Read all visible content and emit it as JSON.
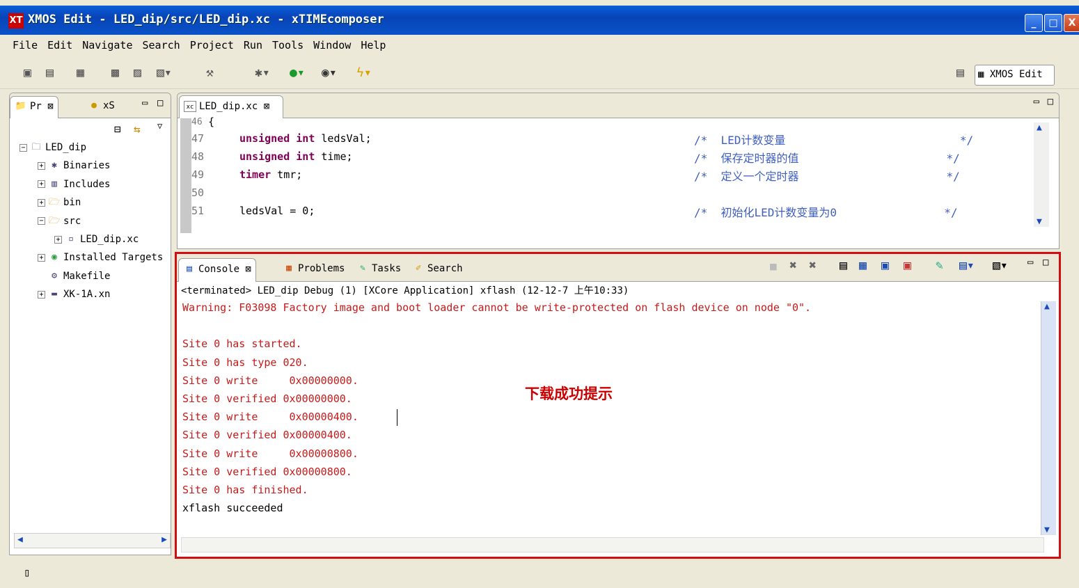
{
  "window": {
    "title": "XMOS Edit - LED_dip/src/LED_dip.xc - xTIMEcomposer",
    "app_icon": "XT",
    "min_glyph": "_",
    "max_glyph": "□",
    "close_glyph": "X"
  },
  "menu": [
    "File",
    "Edit",
    "Navigate",
    "Search",
    "Project",
    "Run",
    "Tools",
    "Window",
    "Help"
  ],
  "perspective": {
    "label": "XMOS Edit"
  },
  "left_panel": {
    "tabs": [
      {
        "label": "Pr ⊠"
      },
      {
        "label": "xS"
      }
    ],
    "tree": [
      {
        "label": "LED_dip",
        "indent": 0,
        "toggle": "⊟",
        "icon": "project-icon"
      },
      {
        "label": "Binaries",
        "indent": 1,
        "toggle": "⊞",
        "icon": "binaries-icon"
      },
      {
        "label": "Includes",
        "indent": 1,
        "toggle": "⊞",
        "icon": "includes-icon"
      },
      {
        "label": "bin",
        "indent": 1,
        "toggle": "⊞",
        "icon": "folder-icon"
      },
      {
        "label": "src",
        "indent": 1,
        "toggle": "⊟",
        "icon": "folder-icon"
      },
      {
        "label": "LED_dip.xc",
        "indent": 2,
        "toggle": "⊞",
        "icon": "xc-file-icon"
      },
      {
        "label": "Installed Targets",
        "indent": 1,
        "toggle": "⊞",
        "icon": "target-icon"
      },
      {
        "label": "Makefile",
        "indent": 1,
        "toggle": "",
        "icon": "makefile-icon"
      },
      {
        "label": "XK-1A.xn",
        "indent": 1,
        "toggle": "⊞",
        "icon": "board-icon"
      }
    ]
  },
  "editor": {
    "tab_label": "LED_dip.xc ⊠",
    "lines": [
      {
        "num": "46",
        "code": "{",
        "kw": "",
        "comment": ""
      },
      {
        "num": "47",
        "kw": "unsigned int",
        "code": " ledsVal;",
        "comment": "/*  LED计数变量                          */"
      },
      {
        "num": "48",
        "kw": "unsigned int",
        "code": " time;",
        "comment": "/*  保存定时器的值                      */"
      },
      {
        "num": "49",
        "kw": "timer",
        "code": " tmr;",
        "comment": "/*  定义一个定时器                      */"
      },
      {
        "num": "50",
        "kw": "",
        "code": "",
        "comment": ""
      },
      {
        "num": "51",
        "kw": "",
        "code": "ledsVal = 0;",
        "comment": "/*  初始化LED计数变量为0                */"
      }
    ]
  },
  "console": {
    "tabs": [
      {
        "label": "Console ⊠"
      },
      {
        "label": "Problems"
      },
      {
        "label": "Tasks"
      },
      {
        "label": "Search"
      }
    ],
    "header": "<terminated> LED_dip Debug (1) [XCore Application] xflash (12-12-7 上午10:33)",
    "lines": [
      {
        "text": "Warning: F03098 Factory image and boot loader cannot be write-protected on flash device on node \"0\".",
        "color": "red"
      },
      {
        "text": "",
        "color": "red"
      },
      {
        "text": "Site 0 has started.",
        "color": "red"
      },
      {
        "text": "Site 0 has type 020.",
        "color": "red"
      },
      {
        "text": "Site 0 write     0x00000000.",
        "color": "red"
      },
      {
        "text": "Site 0 verified 0x00000000.",
        "color": "red"
      },
      {
        "text": "Site 0 write     0x00000400.",
        "color": "red"
      },
      {
        "text": "Site 0 verified 0x00000400.",
        "color": "red"
      },
      {
        "text": "Site 0 write     0x00000800.",
        "color": "red"
      },
      {
        "text": "Site 0 verified 0x00000800.",
        "color": "red"
      },
      {
        "text": "Site 0 has finished.",
        "color": "red"
      },
      {
        "text": "xflash succeeded",
        "color": "black"
      }
    ],
    "annotation": "下载成功提示"
  },
  "colors": {
    "highlight_border": "#d01010",
    "console_error": "#c81919",
    "keyword": "#7f0055",
    "comment": "#3f5fbf"
  }
}
